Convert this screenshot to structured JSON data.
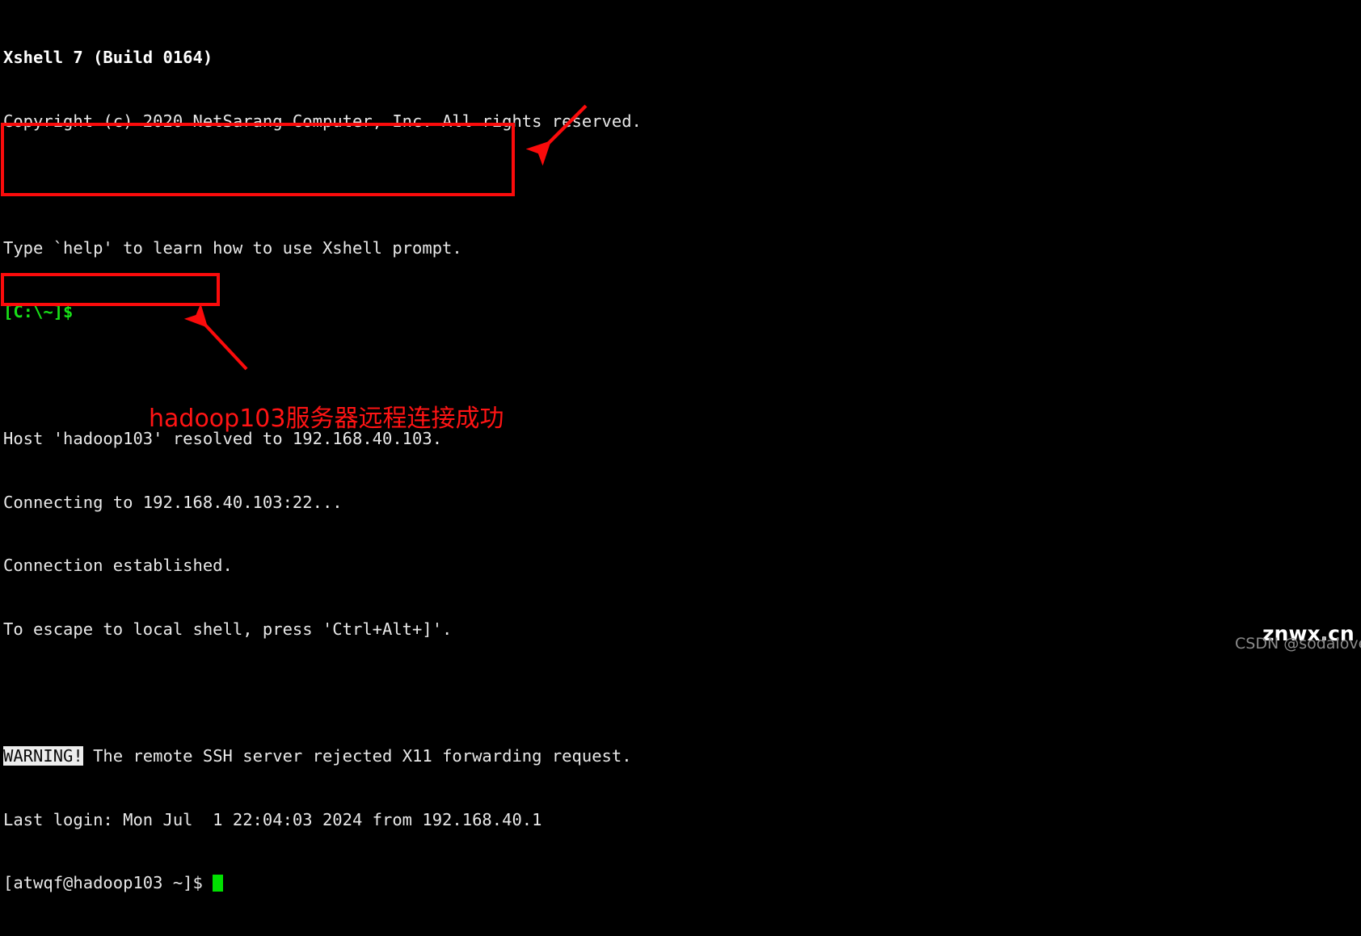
{
  "app": {
    "name": "Xshell",
    "title": "Xshell 7 (Build 0164)"
  },
  "terminal": {
    "lines": [
      {
        "text": "Xshell 7 (Build 0164)",
        "style": "bold"
      },
      {
        "text": "Copyright (c) 2020 NetSarang Computer, Inc. All rights reserved.",
        "style": "normal"
      },
      {
        "text": "",
        "style": "blank"
      },
      {
        "text": "Type `help' to learn how to use Xshell prompt.",
        "style": "normal"
      },
      {
        "text": "[C:\\~]$",
        "style": "green"
      },
      {
        "text": "",
        "style": "blank"
      },
      {
        "text": "Host 'hadoop103' resolved to 192.168.40.103.",
        "style": "normal"
      },
      {
        "text": "Connecting to 192.168.40.103:22...",
        "style": "normal"
      },
      {
        "text": "Connection established.",
        "style": "normal"
      },
      {
        "text": "To escape to local shell, press 'Ctrl+Alt+]'.",
        "style": "normal"
      },
      {
        "text": "",
        "style": "blank"
      },
      {
        "text": "WARNING!",
        "style": "inverse-prefix",
        "rest": " The remote SSH server rejected X11 forwarding request."
      },
      {
        "text": "Last login: Mon Jul  1 22:04:03 2024 from 192.168.40.1",
        "style": "normal"
      },
      {
        "text": "[atwqf@hadoop103 ~]$ ",
        "style": "prompt-cursor"
      }
    ],
    "line0": "Xshell 7 (Build 0164)",
    "line1": "Copyright (c) 2020 NetSarang Computer, Inc. All rights reserved.",
    "line3": "Type `help' to learn how to use Xshell prompt.",
    "line4": "[C:\\~]$",
    "line6": "Host 'hadoop103' resolved to 192.168.40.103.",
    "line7": "Connecting to 192.168.40.103:22...",
    "line8": "Connection established.",
    "line9": "To escape to local shell, press 'Ctrl+Alt+]'.",
    "warning_badge": "WARNING!",
    "warning_rest": " The remote SSH server rejected X11 forwarding request.",
    "line12": "Last login: Mon Jul  1 22:04:03 2024 from 192.168.40.1",
    "shell_prompt": "[atwqf@hadoop103 ~]$ "
  },
  "annotations": {
    "caption": "hadoop103服务器远程连接成功",
    "box_connect_label": "Connection messages highlight box",
    "box_prompt_label": "Shell prompt highlight box",
    "arrow_top_label": "arrow pointing to connection messages",
    "arrow_bottom_label": "arrow pointing to shell prompt"
  },
  "watermarks": {
    "site": "znwx.cn",
    "credit": "CSDN @sodaloveer"
  },
  "colors": {
    "background": "#000000",
    "foreground": "#e8e8e8",
    "prompt_green": "#18e018",
    "cursor_green": "#00e000",
    "annotation_red": "#fb0b0b",
    "caption_red": "#ff1414",
    "inverse_bg": "#ededed",
    "watermark_white": "#ffffff",
    "watermark_gray": "#8a8a8a"
  }
}
